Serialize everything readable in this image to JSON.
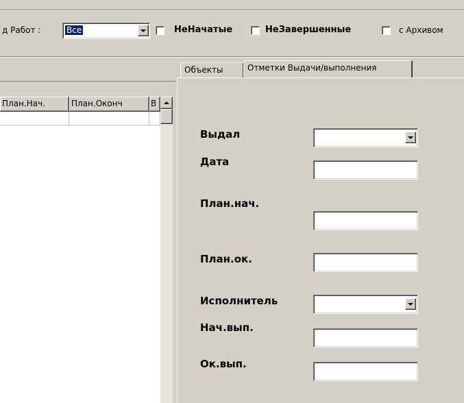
{
  "toolbar": {
    "work_type_label": "д Работ :",
    "work_type_value": "Все",
    "not_started_label": "НеНачатые",
    "not_completed_label": "НеЗавершенные",
    "with_archive_label": "с Архивом"
  },
  "grid": {
    "columns": [
      "План.Нач.",
      "План.Оконч",
      "В"
    ]
  },
  "tabs": [
    {
      "label": "Объекты",
      "active": false
    },
    {
      "label": "Отметки Выдачи/выполнения",
      "active": true
    }
  ],
  "form": {
    "issued_label": "Выдал",
    "date_label": "Дата",
    "plan_start_label": "План.нач.",
    "plan_end_label": "План.ок.",
    "executor_label": "Исполнитель",
    "exec_start_label": "Нач.вып.",
    "exec_end_label": "Ок.вып."
  }
}
